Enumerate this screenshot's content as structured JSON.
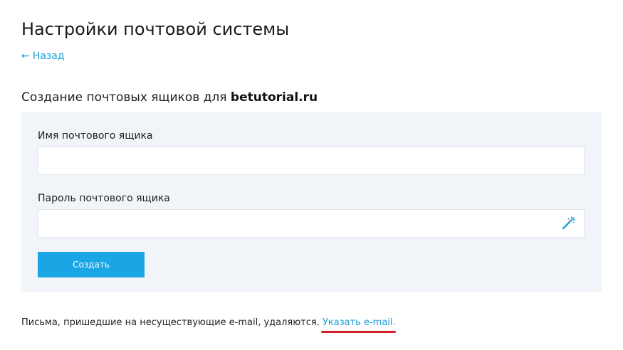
{
  "header": {
    "title": "Настройки почтовой системы",
    "back_arrow": "←",
    "back_label": "Назад"
  },
  "section": {
    "title_prefix": "Создание почтовых ящиков для ",
    "domain": "betutorial.ru"
  },
  "form": {
    "mailbox_name_label": "Имя почтового ящика",
    "mailbox_name_value": "",
    "mailbox_password_label": "Пароль почтового ящика",
    "mailbox_password_value": "",
    "generate_password_icon": "magic-wand-icon",
    "create_button_label": "Создать"
  },
  "footer": {
    "note_text": "Письма, пришедшие на несуществующие e-mail, удаляются. ",
    "specify_link_label": "Указать e-mail."
  },
  "colors": {
    "link": "#1a9fd9",
    "button": "#1aa5e4",
    "panel_background": "#f1f4f8",
    "annotation_underline": "#d4202b"
  }
}
